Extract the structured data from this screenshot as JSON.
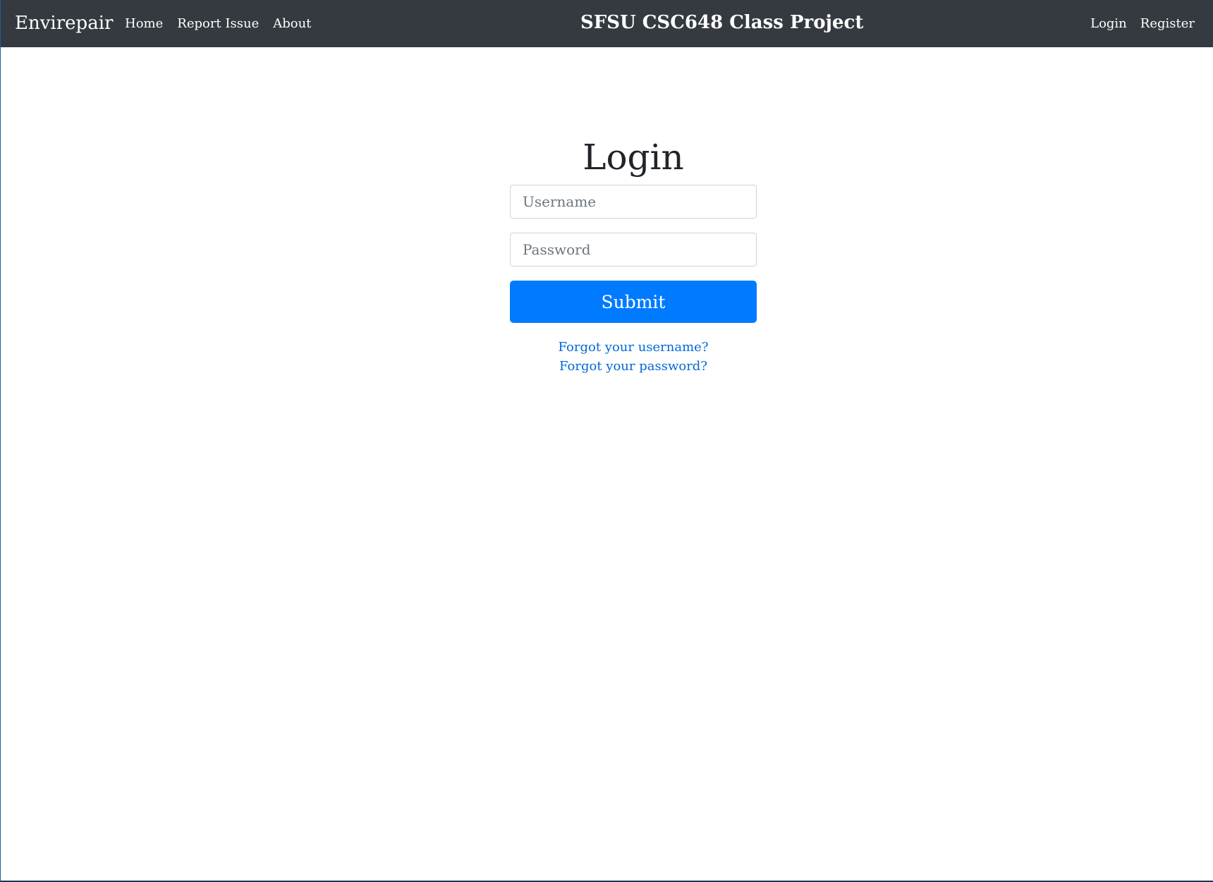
{
  "navbar": {
    "brand": "Envirepair",
    "links": [
      {
        "label": "Home"
      },
      {
        "label": "Report Issue"
      },
      {
        "label": "About"
      }
    ],
    "center_title": "SFSU CSC648 Class Project",
    "right_links": [
      {
        "label": "Login"
      },
      {
        "label": "Register"
      }
    ]
  },
  "login": {
    "title": "Login",
    "username": {
      "value": "",
      "placeholder": "Username"
    },
    "password": {
      "value": "",
      "placeholder": "Password"
    },
    "submit_label": "Submit",
    "forgot_username": "Forgot your username?",
    "forgot_password": "Forgot your password?"
  },
  "colors": {
    "navbar_bg": "#343a40",
    "primary": "#007bff",
    "link": "#0069d9"
  }
}
